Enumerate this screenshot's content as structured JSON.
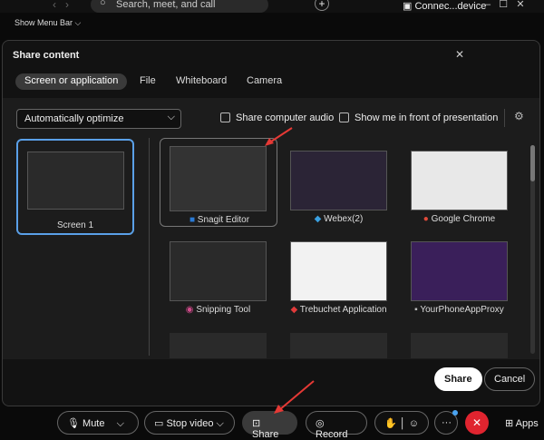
{
  "topbar": {
    "search_placeholder": "Search, meet, and call",
    "connect": "Connec...device"
  },
  "menu_bar": "Show Menu Bar",
  "dialog": {
    "title": "Share content",
    "tabs": [
      {
        "label": "Screen or application",
        "active": true
      },
      {
        "label": "File"
      },
      {
        "label": "Whiteboard"
      },
      {
        "label": "Camera"
      }
    ],
    "optimize": "Automatically optimize",
    "share_audio": {
      "label": "Share computer audio",
      "checked": false
    },
    "show_me": {
      "label": "Show me in front of presentation",
      "checked": false
    },
    "screens": [
      {
        "label": "Screen 1",
        "selected": true
      }
    ],
    "apps": [
      {
        "label": "Snagit Editor",
        "icon_color": "#2a7ad5"
      },
      {
        "label": "Webex(2)",
        "icon_color": "#3aa0e0"
      },
      {
        "label": "Google Chrome",
        "icon_color": "#e04a3a"
      },
      {
        "label": "Snipping Tool",
        "icon_color": "#d04a8a"
      },
      {
        "label": "Trebuchet Application",
        "icon_color": "#e03a3a"
      },
      {
        "label": "YourPhoneAppProxy",
        "icon_color": "#bbbbbb"
      }
    ],
    "share_button": "Share",
    "cancel_button": "Cancel"
  },
  "toolbar": {
    "mute": "Mute",
    "stop_video": "Stop video",
    "share": "Share",
    "record": "Record",
    "apps": "Apps"
  },
  "accent": "#e0242f"
}
